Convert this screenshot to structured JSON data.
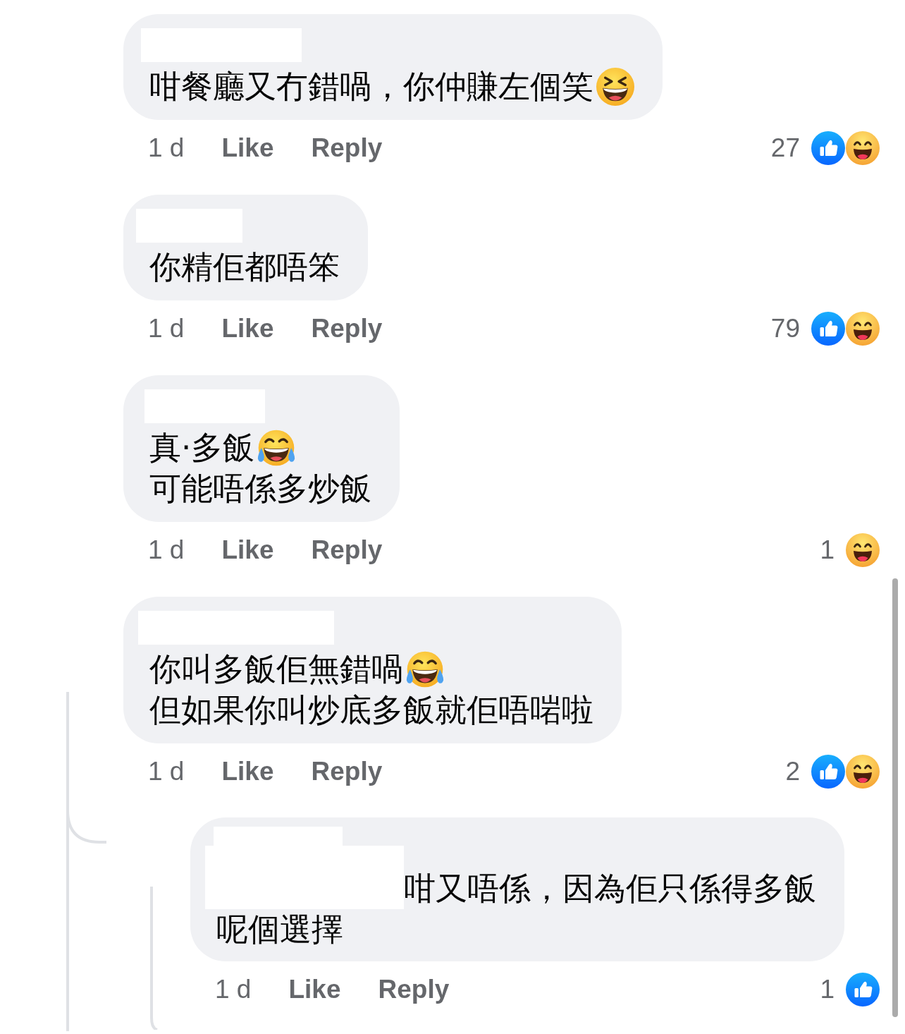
{
  "comments": [
    {
      "lines": [
        {
          "text": "咁餐廳又冇錯喎，你仲賺左個笑",
          "emoji": {
            "kind": "grin-squint"
          }
        }
      ],
      "time": "1 d",
      "like": "Like",
      "reply": "Reply",
      "reaction_count": "27",
      "reactions": [
        {
          "kind": "like"
        },
        {
          "kind": "haha"
        }
      ]
    },
    {
      "lines": [
        {
          "text": "你精佢都唔笨"
        }
      ],
      "time": "1 d",
      "like": "Like",
      "reply": "Reply",
      "reaction_count": "79",
      "reactions": [
        {
          "kind": "like"
        },
        {
          "kind": "haha"
        }
      ]
    },
    {
      "lines": [
        {
          "text": "真·多飯",
          "emoji": {
            "kind": "tears-of-joy"
          }
        },
        {
          "text": "可能唔係多炒飯"
        }
      ],
      "time": "1 d",
      "like": "Like",
      "reply": "Reply",
      "reaction_count": "1",
      "reactions": [
        {
          "kind": "haha"
        }
      ]
    },
    {
      "lines": [
        {
          "text": "你叫多飯佢無錯喎",
          "emoji": {
            "kind": "tears-of-joy"
          }
        },
        {
          "text": "但如果你叫炒底多飯就佢唔啱啦"
        }
      ],
      "time": "1 d",
      "like": "Like",
      "reply": "Reply",
      "reaction_count": "2",
      "reactions": [
        {
          "kind": "like"
        },
        {
          "kind": "haha"
        }
      ],
      "replies": [
        {
          "lines": [
            {
              "text": "咁又唔係，因為佢只係得多飯"
            },
            {
              "text": "呢個選擇"
            }
          ],
          "time": "1 d",
          "like": "Like",
          "reply": "Reply",
          "reaction_count": "1",
          "reactions": [
            {
              "kind": "like"
            }
          ]
        }
      ]
    }
  ]
}
